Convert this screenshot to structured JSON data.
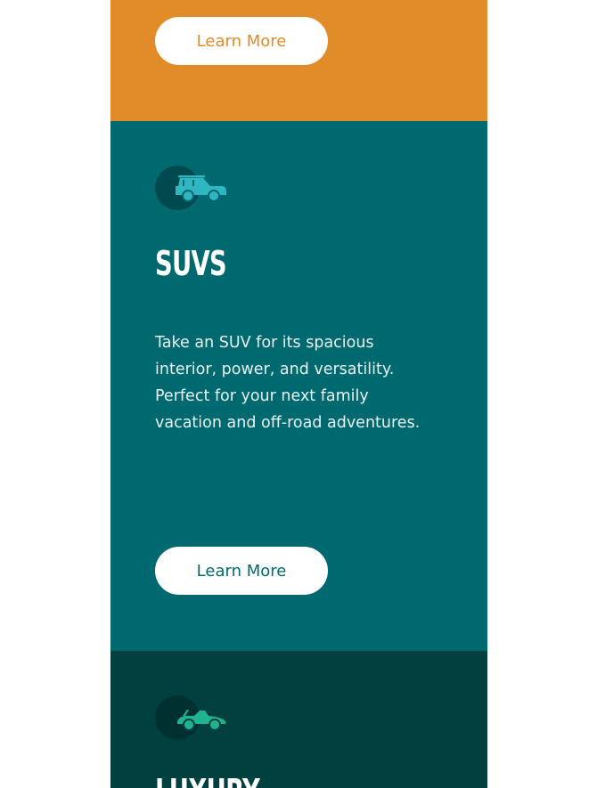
{
  "cards": {
    "sedans": {
      "button_label": "Learn More",
      "color": "#e28b29"
    },
    "suvs": {
      "icon": "suv-icon",
      "title": "SUVS",
      "description": "Take an SUV for its spacious interior, power, and versatility. Perfect for your next family vacation and off-road adventures.",
      "button_label": "Learn More",
      "color": "#006970"
    },
    "luxury": {
      "icon": "luxury-car-icon",
      "title": "LUXURY",
      "color": "#004140"
    }
  }
}
